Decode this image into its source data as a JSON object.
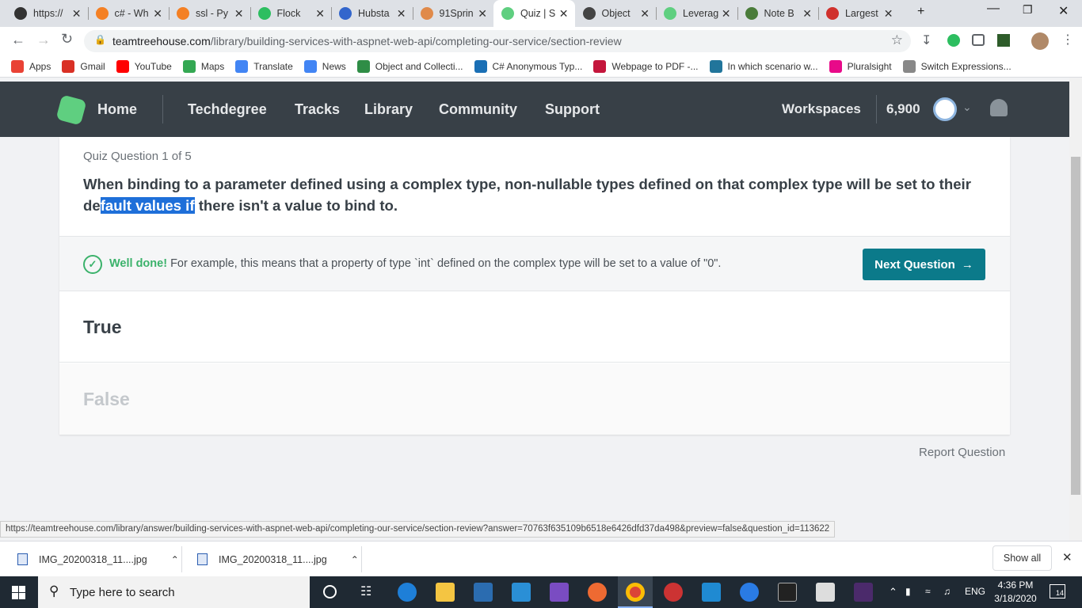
{
  "browser": {
    "tabs": [
      {
        "title": "https://",
        "icon": "github-icon",
        "color": "#333333"
      },
      {
        "title": "c# - Wh",
        "icon": "stackoverflow-icon",
        "color": "#f48024"
      },
      {
        "title": "ssl - Py",
        "icon": "stackoverflow-icon",
        "color": "#f48024"
      },
      {
        "title": "Flock",
        "icon": "flock-icon",
        "color": "#2dbe60"
      },
      {
        "title": "Hubsta",
        "icon": "hubstaff-icon",
        "color": "#3366cc"
      },
      {
        "title": "91Sprin",
        "icon": "sprint-icon",
        "color": "#e08a4a"
      },
      {
        "title": "Quiz | S",
        "icon": "treehouse-icon",
        "color": "#5fcf80",
        "active": true
      },
      {
        "title": "Object",
        "icon": "book-icon",
        "color": "#444444"
      },
      {
        "title": "Leverag",
        "icon": "treehouse-icon",
        "color": "#5fcf80"
      },
      {
        "title": "Note B",
        "icon": "note-icon",
        "color": "#4a7c3a"
      },
      {
        "title": "Largest",
        "icon": "tg-icon",
        "color": "#d0312d"
      }
    ],
    "new_tab": "+",
    "url_host": "teamtreehouse.com",
    "url_path": "/library/building-services-with-aspnet-web-api/completing-our-service/section-review",
    "bookmarks": [
      {
        "label": "Apps",
        "icon": "apps-grid-icon",
        "color": "#e94235"
      },
      {
        "label": "Gmail",
        "icon": "gmail-icon",
        "color": "#d93025"
      },
      {
        "label": "YouTube",
        "icon": "youtube-icon",
        "color": "#ff0000"
      },
      {
        "label": "Maps",
        "icon": "maps-icon",
        "color": "#34a853"
      },
      {
        "label": "Translate",
        "icon": "translate-icon",
        "color": "#4285f4"
      },
      {
        "label": "News",
        "icon": "news-icon",
        "color": "#4285f4"
      },
      {
        "label": "Object and Collecti...",
        "icon": "gfg-icon",
        "color": "#2f8d46"
      },
      {
        "label": "C# Anonymous Typ...",
        "icon": "tutorials-icon",
        "color": "#1a6fb5"
      },
      {
        "label": "Webpage to PDF -...",
        "icon": "pdf-icon",
        "color": "#c4163c"
      },
      {
        "label": "In which scenario w...",
        "icon": "wordpress-icon",
        "color": "#21759b"
      },
      {
        "label": "Pluralsight",
        "icon": "pluralsight-icon",
        "color": "#e80a89"
      },
      {
        "label": "Switch Expressions...",
        "icon": "docs-icon",
        "color": "#888888"
      }
    ]
  },
  "site": {
    "nav": [
      "Home",
      "Techdegree",
      "Tracks",
      "Library",
      "Community",
      "Support"
    ],
    "workspaces": "Workspaces",
    "points": "6,900"
  },
  "quiz": {
    "counter": "Quiz Question 1 of 5",
    "question_before": "When binding to a parameter defined using a complex type, non-nullable types defined on that complex type will be set to their de",
    "question_highlight": "fault values if",
    "question_after": " there isn't a value to bind to.",
    "feedback_title": "Well done!",
    "feedback_text": " For example, this means that a property of type `int` defined on the complex type will be set to a value of \"0\".",
    "next_label": "Next Question",
    "answers": [
      {
        "label": "True",
        "color": "#384047"
      },
      {
        "label": "False",
        "color": "#c4c8cc"
      }
    ],
    "report": "Report Question"
  },
  "status_url": "https://teamtreehouse.com/library/answer/building-services-with-aspnet-web-api/completing-our-service/section-review?answer=70763f635109b6518e6426dfd37da498&preview=false&question_id=113622",
  "downloads": {
    "items": [
      "IMG_20200318_11....jpg",
      "IMG_20200318_11....jpg"
    ],
    "show_all": "Show all"
  },
  "taskbar": {
    "search_placeholder": "Type here to search",
    "lang": "ENG",
    "time": "4:36 PM",
    "date": "3/18/2020",
    "notifications": "14"
  }
}
